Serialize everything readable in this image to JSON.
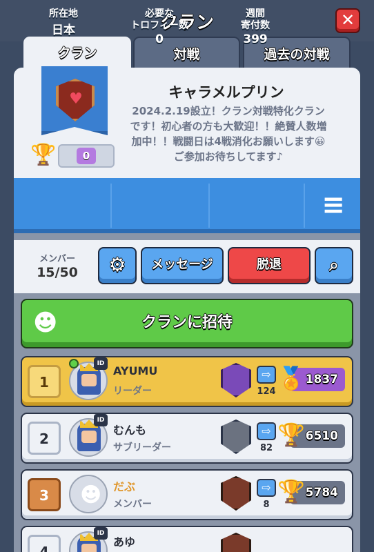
{
  "header": {
    "title": "クラン",
    "close_icon": "close-icon"
  },
  "tabs": [
    {
      "label": "クラン",
      "active": true
    },
    {
      "label": "対戦",
      "active": false
    },
    {
      "label": "過去の対戦",
      "active": false
    }
  ],
  "clan": {
    "name": "キャラメルプリン",
    "description": "2024.2.19設立！クラン対戦特化クランです！初心者の方も大歓迎！！絶賛人数増加中！！戦闘日は4戦消化お願いします😀ご参加お待ちしてます♪",
    "trophy_value": "0",
    "badge_icon": "heart-shield-icon"
  },
  "stats": {
    "location_label": "所在地",
    "location_value": "日本",
    "required_label_1": "必要な",
    "required_label_2": "トロフィー数",
    "required_value": "0",
    "weekly_label_1": "週間",
    "weekly_label_2": "寄付数",
    "weekly_value": "399",
    "list_icon": "list-add-icon"
  },
  "controls": {
    "members_label": "メンバー",
    "members_count": "15/50",
    "settings_icon": "gear-icon",
    "message_label": "メッセージ",
    "leave_label": "脱退",
    "search_icon": "search-icon"
  },
  "invite": {
    "label": "クランに招待",
    "icon": "person-icon"
  },
  "members": [
    {
      "rank": "1",
      "name": "AYUMU",
      "role": "リーダー",
      "donations": "124",
      "trophies": "1837",
      "online": true,
      "highlight": true
    },
    {
      "rank": "2",
      "name": "むんも",
      "role": "サブリーダー",
      "donations": "82",
      "trophies": "6510",
      "online": false,
      "highlight": false
    },
    {
      "rank": "3",
      "name": "だぶ",
      "role": "メンバー",
      "donations": "8",
      "trophies": "5784",
      "online": false,
      "highlight": false
    },
    {
      "rank": "4",
      "name": "あゆ",
      "role": "",
      "donations": "",
      "trophies": "",
      "online": false,
      "highlight": false
    }
  ],
  "colors": {
    "accent_blue": "#3d8ee0",
    "invite_green": "#5fca48",
    "leave_red": "#ee4848",
    "leader_gold": "#f0c448"
  }
}
